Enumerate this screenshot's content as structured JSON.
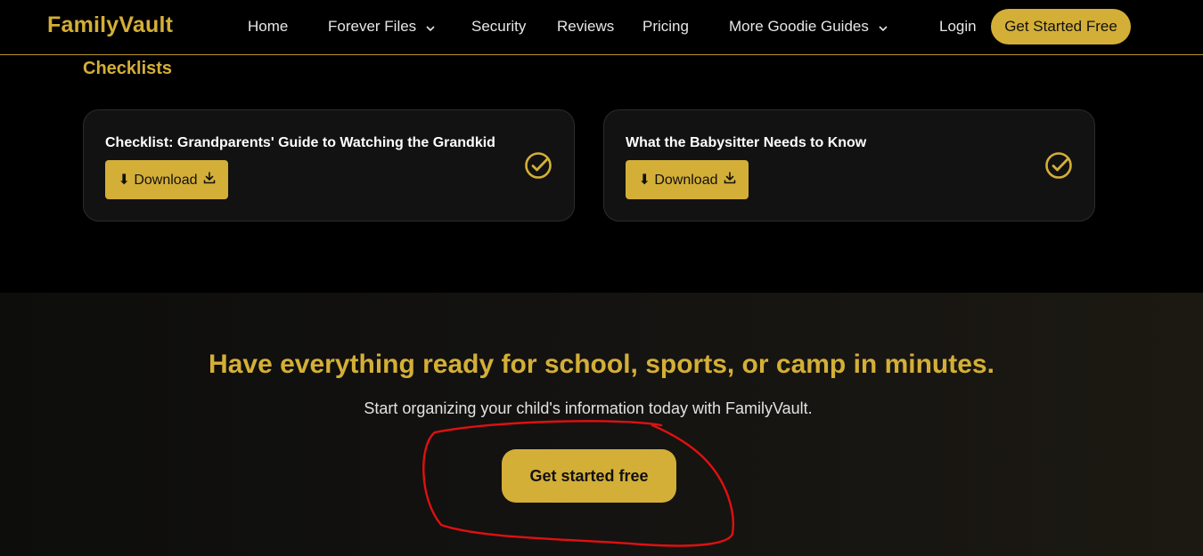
{
  "nav": {
    "brand": "FamilyVault",
    "links": [
      "Home",
      "Forever Files",
      "Security",
      "Reviews",
      "Pricing",
      "More Goodie Guides"
    ],
    "login": "Login",
    "cta": "Get Started Free"
  },
  "checklists": {
    "title": "Checklists",
    "cards": [
      {
        "title": "Checklist: Grandparents' Guide to Watching the Grandkid",
        "button": "⬇ Download"
      },
      {
        "title": "What the Babysitter Needs to Know",
        "button": "⬇ Download"
      }
    ]
  },
  "cta_section": {
    "heading": "Have everything ready for school, sports, or camp in minutes.",
    "subtext": "Start organizing your child's information today with FamilyVault.",
    "button": "Get started free"
  },
  "icons": {
    "chevron": "chevron-down-icon",
    "download": "download-icon",
    "check": "check-circle-icon"
  },
  "colors": {
    "accent": "#d4af37",
    "background": "#000000",
    "card": "#121212",
    "annotation": "#e01010"
  }
}
